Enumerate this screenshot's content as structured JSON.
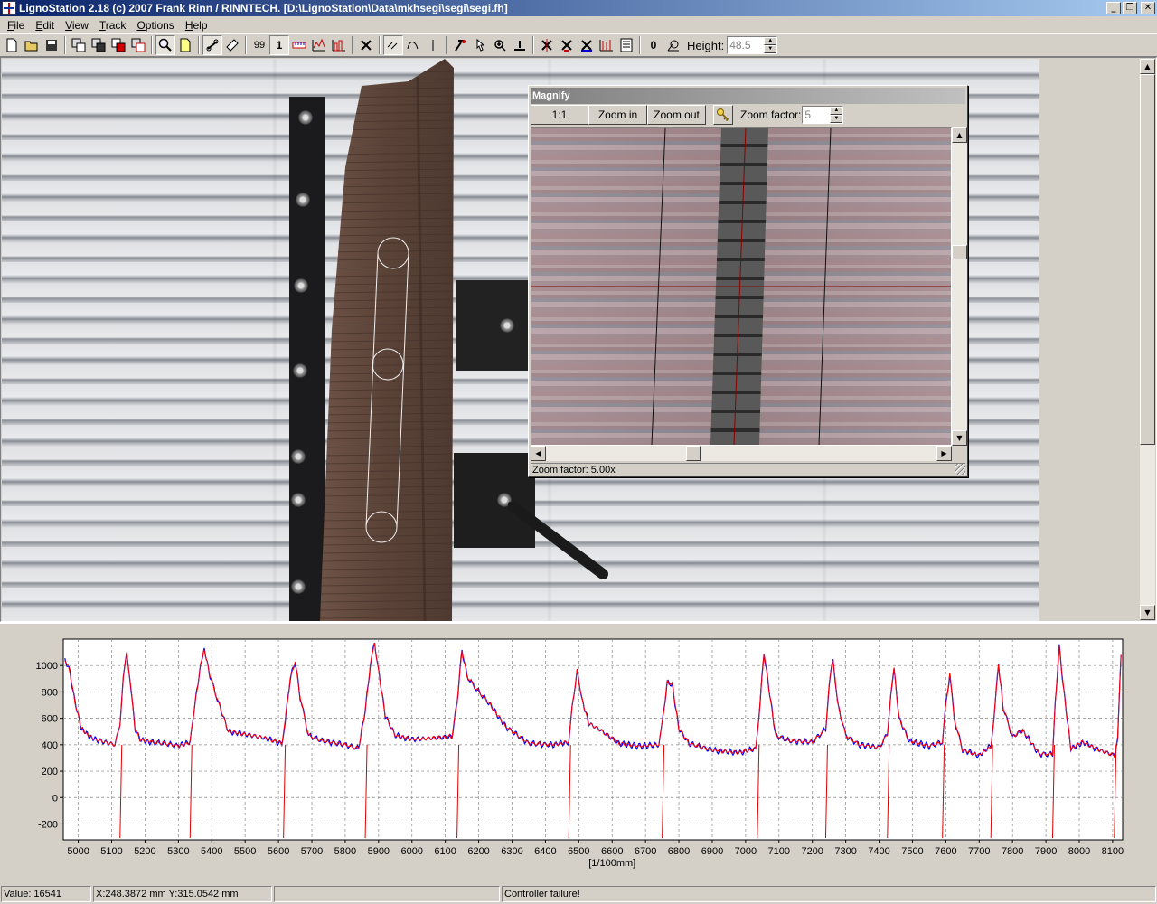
{
  "window": {
    "title": "LignoStation 2.18 (c) 2007 Frank Rinn / RINNTECH.  [D:\\LignoStation\\Data\\mkhsegi\\segi\\segi.fh]",
    "buttons": [
      "minimize",
      "restore",
      "close"
    ]
  },
  "menu": [
    "File",
    "Edit",
    "View",
    "Track",
    "Options",
    "Help"
  ],
  "toolbar": {
    "label_99": "99",
    "label_1": "1",
    "label_0": "0",
    "height_label": "Height:",
    "height_value": "48.5"
  },
  "magnify": {
    "title": "Magnify",
    "btn_1to1": "1:1",
    "btn_zoom_in": "Zoom in",
    "btn_zoom_out": "Zoom out",
    "zoom_label": "Zoom factor:",
    "zoom_value": "5",
    "status": "Zoom factor: 5.00x"
  },
  "chart_data": {
    "type": "line",
    "xlabel": "[1/100mm]",
    "ylabel": "",
    "xlim": [
      4955,
      8130
    ],
    "ylim": [
      -320,
      1200
    ],
    "x_ticks": [
      5000,
      5100,
      5200,
      5300,
      5400,
      5500,
      5600,
      5700,
      5800,
      5900,
      6000,
      6100,
      6200,
      6300,
      6400,
      6500,
      6600,
      6700,
      6800,
      6900,
      7000,
      7100,
      7200,
      7300,
      7400,
      7500,
      7600,
      7700,
      7800,
      7900,
      8000,
      8100
    ],
    "y_ticks": [
      -200,
      0,
      200,
      400,
      600,
      800,
      1000
    ],
    "grid": true,
    "series_colors": [
      "#0000ff",
      "#ff0000"
    ],
    "ring_boundaries": [
      5125,
      5335,
      5615,
      5860,
      6135,
      6470,
      6750,
      7035,
      7240,
      7425,
      7590,
      7735,
      7920,
      8105
    ],
    "density_profile": {
      "x": [
        4960,
        4975,
        4990,
        5010,
        5030,
        5050,
        5080,
        5110,
        5125,
        5135,
        5145,
        5155,
        5170,
        5185,
        5220,
        5260,
        5300,
        5335,
        5350,
        5370,
        5378,
        5395,
        5420,
        5450,
        5500,
        5560,
        5610,
        5620,
        5635,
        5650,
        5665,
        5690,
        5730,
        5800,
        5840,
        5860,
        5875,
        5888,
        5900,
        5920,
        5950,
        6000,
        6060,
        6120,
        6135,
        6150,
        6165,
        6190,
        6230,
        6280,
        6350,
        6420,
        6470,
        6480,
        6495,
        6510,
        6530,
        6560,
        6620,
        6680,
        6740,
        6750,
        6765,
        6780,
        6800,
        6830,
        6900,
        6980,
        7030,
        7040,
        7055,
        7070,
        7090,
        7130,
        7200,
        7240,
        7250,
        7262,
        7275,
        7300,
        7340,
        7400,
        7425,
        7435,
        7445,
        7460,
        7490,
        7550,
        7590,
        7600,
        7612,
        7625,
        7650,
        7700,
        7735,
        7745,
        7758,
        7772,
        7800,
        7830,
        7880,
        7920,
        7928,
        7940,
        7955,
        7975,
        8010,
        8060,
        8105,
        8115,
        8125
      ],
      "y": [
        1050,
        950,
        720,
        520,
        470,
        440,
        420,
        400,
        560,
        900,
        1100,
        900,
        520,
        440,
        420,
        410,
        390,
        420,
        720,
        1050,
        1120,
        920,
        720,
        500,
        480,
        450,
        410,
        580,
        900,
        1030,
        760,
        470,
        430,
        400,
        370,
        660,
        1000,
        1170,
        960,
        620,
        470,
        440,
        450,
        460,
        720,
        1120,
        920,
        830,
        720,
        540,
        410,
        400,
        420,
        680,
        960,
        740,
        560,
        520,
        410,
        390,
        400,
        560,
        870,
        860,
        520,
        410,
        360,
        340,
        370,
        620,
        1100,
        820,
        470,
        430,
        420,
        520,
        850,
        1060,
        720,
        470,
        400,
        380,
        480,
        790,
        970,
        600,
        430,
        390,
        420,
        700,
        940,
        600,
        360,
        320,
        390,
        620,
        1010,
        680,
        460,
        510,
        330,
        330,
        720,
        1140,
        780,
        370,
        420,
        360,
        320,
        460,
        1080
      ]
    }
  },
  "status": {
    "value": "Value: 16541",
    "coords": "X:248.3872 mm  Y:315.0542 mm",
    "empty": "",
    "message": "Controller failure!"
  }
}
